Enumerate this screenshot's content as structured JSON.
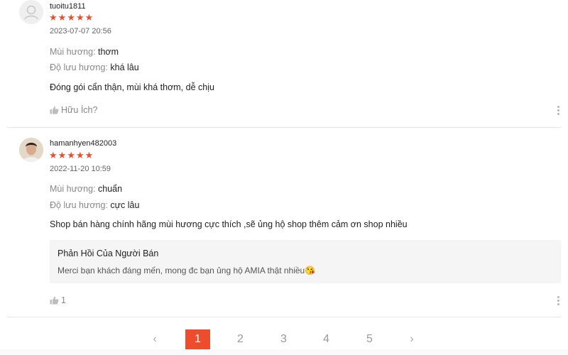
{
  "reviews": [
    {
      "username": "tuoitu1811",
      "stars": [
        "★",
        "★",
        "★",
        "★",
        "★"
      ],
      "date": "2023-07-07 20:56",
      "attrs": [
        {
          "label": "Mùi hương:",
          "value": "thơm"
        },
        {
          "label": "Độ lưu hương:",
          "value": "khá lâu"
        }
      ],
      "comment": "Đóng gói cẩn thận, mùi khá thơm, dễ chịu",
      "helpful": "Hữu Ích?"
    },
    {
      "username": "hamanhyen482003",
      "stars": [
        "★",
        "★",
        "★",
        "★",
        "★"
      ],
      "date": "2022-11-20 10:59",
      "attrs": [
        {
          "label": "Mùi hương:",
          "value": "chuẩn"
        },
        {
          "label": "Độ lưu hương:",
          "value": "cực lâu"
        }
      ],
      "comment": "Shop bán hàng chính hãng mùi hương cực thích ,sẽ ủng hộ shop thêm cảm ơn shop nhiều",
      "seller_reply": {
        "title": "Phản Hồi Của Người Bán",
        "text": "Merci bạn khách đáng mến, mong đc bạn ủng hộ AMIA thật nhiều😘"
      },
      "likes": "1"
    }
  ],
  "pagination": {
    "prev": "‹",
    "pages": [
      "1",
      "2",
      "3",
      "4",
      "5"
    ],
    "current": "1",
    "next": "›"
  },
  "colors": {
    "accent": "#ee4d2d",
    "star": "#ee4d2d"
  }
}
